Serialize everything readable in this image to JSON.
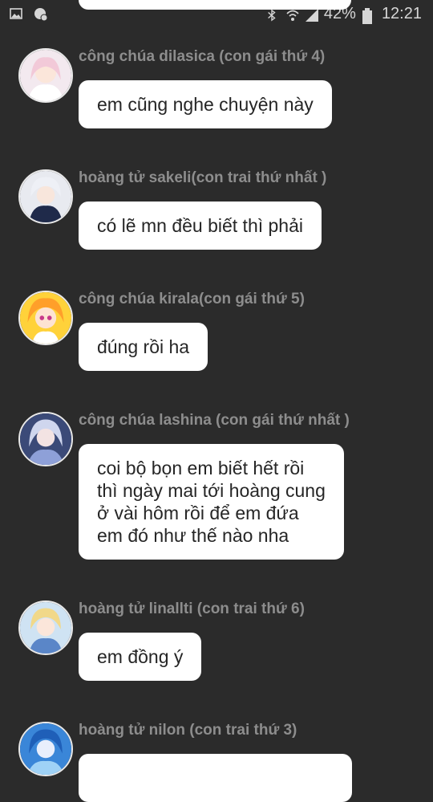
{
  "status_bar": {
    "battery": "42%",
    "time": "12:21",
    "icons": [
      "image-icon",
      "chat-notification-icon",
      "bluetooth-icon",
      "wifi-icon",
      "signal-icon",
      "battery-icon"
    ]
  },
  "messages": [
    {
      "sender": "công chúa dilasica (con gái thứ 4)",
      "text": "em cũng nghe chuyện này"
    },
    {
      "sender": "hoàng tử sakeli(con trai thứ nhất )",
      "text": "có lẽ mn đều biết thì phải"
    },
    {
      "sender": "công chúa kirala(con gái thứ 5)",
      "text": "đúng rồi ha"
    },
    {
      "sender": "công chúa lashina (con gái thứ nhất )",
      "text": "coi bộ bọn em biết hết rồi\nthì ngày mai tới hoàng cung\nở vài hôm rồi để em đứa\nem đó như thế nào nha"
    },
    {
      "sender": "hoàng tử linallti (con trai thứ 6)",
      "text": "em đồng ý"
    },
    {
      "sender": "hoàng tử nilon  (con trai thứ 3)",
      "text": ""
    }
  ],
  "colors": {
    "background": "#2b2b2b",
    "bubble": "#ffffff",
    "sender_name": "#8d8d8d"
  }
}
